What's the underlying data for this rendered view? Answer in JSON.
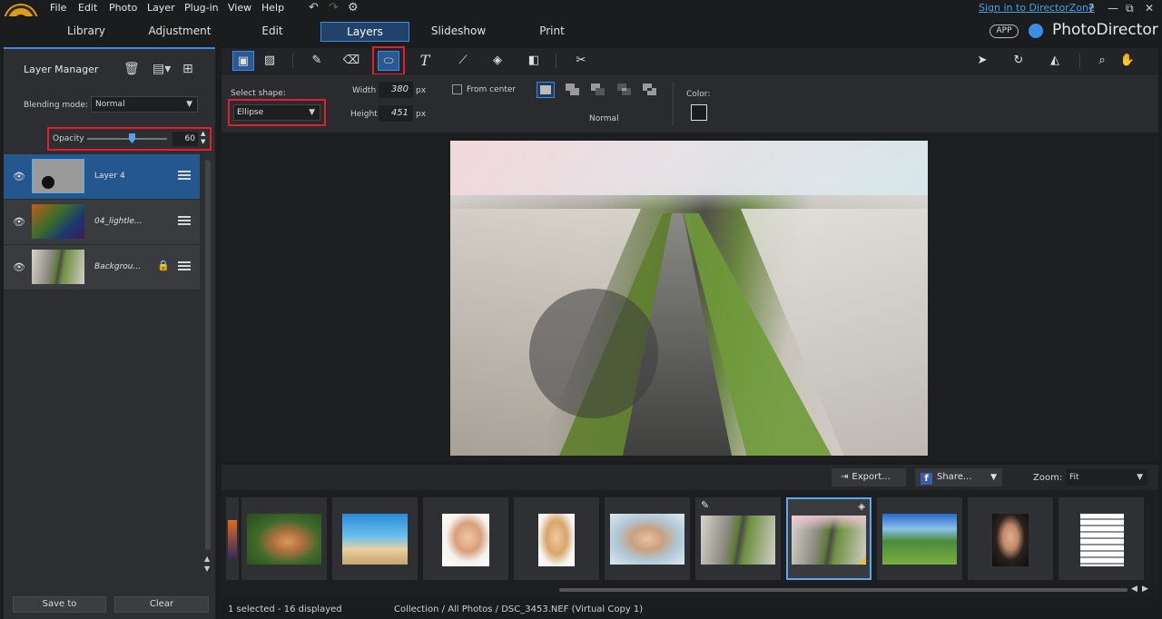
{
  "menu": {
    "items": [
      "File",
      "Edit",
      "Photo",
      "Layer",
      "Plug-in",
      "View",
      "Help"
    ]
  },
  "account": {
    "signin_label": "Sign in to DirectorZone",
    "help_label": "?",
    "minimize": "—",
    "restore": "⧉",
    "close": "✕"
  },
  "modes": {
    "tabs": [
      "Library",
      "Adjustment",
      "Edit",
      "Layers",
      "Slideshow",
      "Print"
    ],
    "active": "Layers"
  },
  "brand": {
    "app_badge": "APP",
    "name": "PhotoDirector"
  },
  "layer_manager": {
    "title": "Layer Manager",
    "blending_label": "Blending mode:",
    "blending_value": "Normal",
    "opacity_label": "Opacity",
    "opacity_value": "60",
    "layers": [
      {
        "name": "Layer 4",
        "selected": true,
        "locked": false
      },
      {
        "name": "04_lightle...",
        "selected": false,
        "locked": false
      },
      {
        "name": "Backgrou...",
        "selected": false,
        "locked": true
      }
    ],
    "save_label": "Save to",
    "clear_label": "Clear"
  },
  "toolbar": {
    "tools": [
      "image-layer-tool",
      "photo-layer-tool",
      "brush-tool",
      "eraser-tool",
      "shape-tool",
      "text-tool",
      "line-tool",
      "fill-tool",
      "gradient-tool",
      "transform-tool"
    ],
    "active_tool": "shape-tool"
  },
  "shape_options": {
    "select_shape_label": "Select shape:",
    "shape_value": "Ellipse",
    "width_label": "Width",
    "width_value": "380",
    "height_label": "Height",
    "height_value": "451",
    "unit": "px",
    "from_center_label": "From center",
    "mode_label": "Normal",
    "color_label": "Color:",
    "color_value": "#1b1c1e"
  },
  "filmstrip": {
    "export_label": "Export...",
    "share_label": "Share...",
    "zoom_label": "Zoom:",
    "zoom_value": "Fit",
    "selected_index": 6
  },
  "status": {
    "selection": "1 selected - 16 displayed",
    "path": "Collection / All Photos / DSC_3453.NEF (Virtual Copy 1)"
  },
  "colors": {
    "accent": "#3d8be0",
    "highlight_box": "#e02030",
    "link": "#4a9fe0"
  }
}
